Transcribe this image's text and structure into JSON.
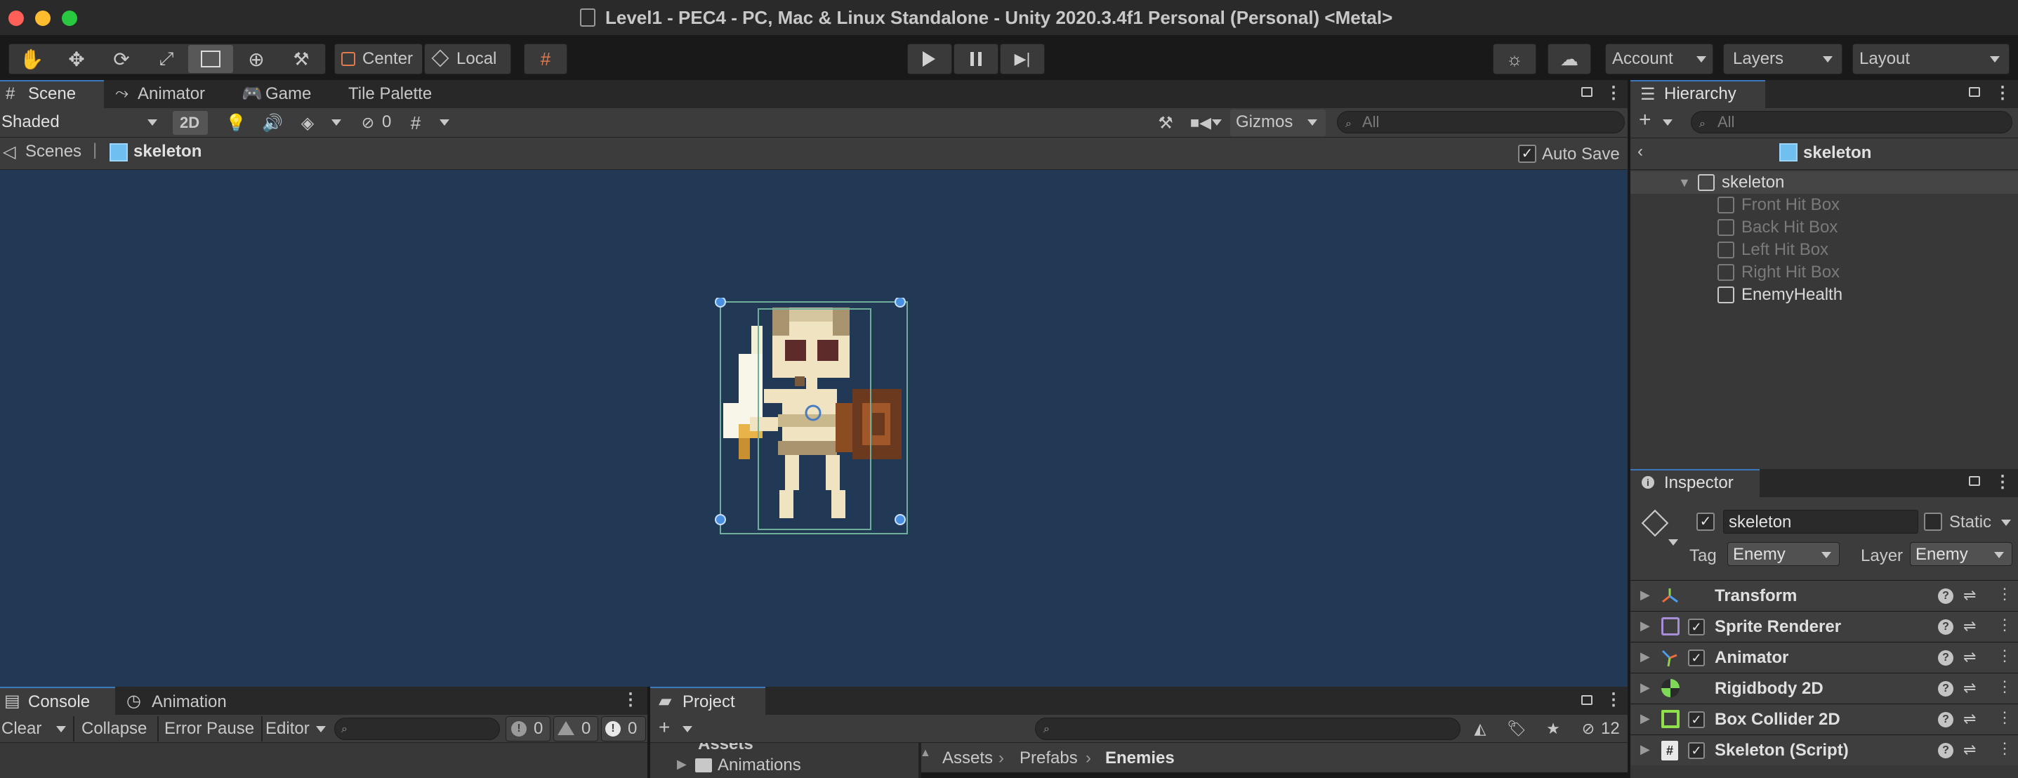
{
  "window": {
    "title": "Level1 - PEC4 - PC, Mac & Linux Standalone - Unity 2020.3.4f1 Personal (Personal) <Metal>"
  },
  "toolbar": {
    "pivot_label": "Center",
    "space_label": "Local",
    "account_label": "Account",
    "layers_label": "Layers",
    "layout_label": "Layout"
  },
  "scene_tabs": [
    {
      "label": "Scene"
    },
    {
      "label": "Animator"
    },
    {
      "label": "Game"
    },
    {
      "label": "Tile Palette"
    }
  ],
  "scene_toolbar": {
    "shading_mode": "Shaded",
    "mode_2d": "2D",
    "hidden_count": "0",
    "gizmos_label": "Gizmos",
    "search_placeholder": "All"
  },
  "scene_breadcrumb": {
    "root": "Scenes",
    "current": "skeleton",
    "auto_save_label": "Auto Save",
    "auto_save_checked": true
  },
  "scene_view": {
    "background_color": "#213955"
  },
  "hierarchy": {
    "tab_label": "Hierarchy",
    "search_placeholder": "All",
    "prefab_title": "skeleton",
    "root": "skeleton",
    "children": [
      {
        "label": "Front Hit Box",
        "active": false
      },
      {
        "label": "Back Hit Box",
        "active": false
      },
      {
        "label": "Left Hit Box",
        "active": false
      },
      {
        "label": "Right Hit Box",
        "active": false
      },
      {
        "label": "EnemyHealth",
        "active": true
      }
    ]
  },
  "inspector": {
    "tab_label": "Inspector",
    "object_name": "skeleton",
    "static_label": "Static",
    "tag_label": "Tag",
    "tag_value": "Enemy",
    "layer_label": "Layer",
    "layer_value": "Enemy",
    "components": [
      {
        "name": "Transform",
        "icon": "transform-icon",
        "checkbox": false
      },
      {
        "name": "Sprite Renderer",
        "icon": "sprite-renderer-icon",
        "checkbox": true
      },
      {
        "name": "Animator",
        "icon": "animator-icon",
        "checkbox": true
      },
      {
        "name": "Rigidbody 2D",
        "icon": "rigidbody2d-icon",
        "checkbox": false
      },
      {
        "name": "Box Collider 2D",
        "icon": "box-collider-icon",
        "checkbox": true
      },
      {
        "name": "Skeleton (Script)",
        "icon": "script-icon",
        "checkbox": true
      }
    ]
  },
  "console": {
    "tabs": [
      {
        "label": "Console"
      },
      {
        "label": "Animation"
      }
    ],
    "clear_label": "Clear",
    "collapse_label": "Collapse",
    "error_pause_label": "Error Pause",
    "editor_label": "Editor",
    "info_count": "0",
    "warning_count": "0",
    "error_count": "0"
  },
  "project": {
    "tab_label": "Project",
    "hidden_count": "12",
    "tree_root": "Assets",
    "tree_child": "Animations",
    "breadcrumb": [
      "Assets",
      "Prefabs",
      "Enemies"
    ]
  }
}
